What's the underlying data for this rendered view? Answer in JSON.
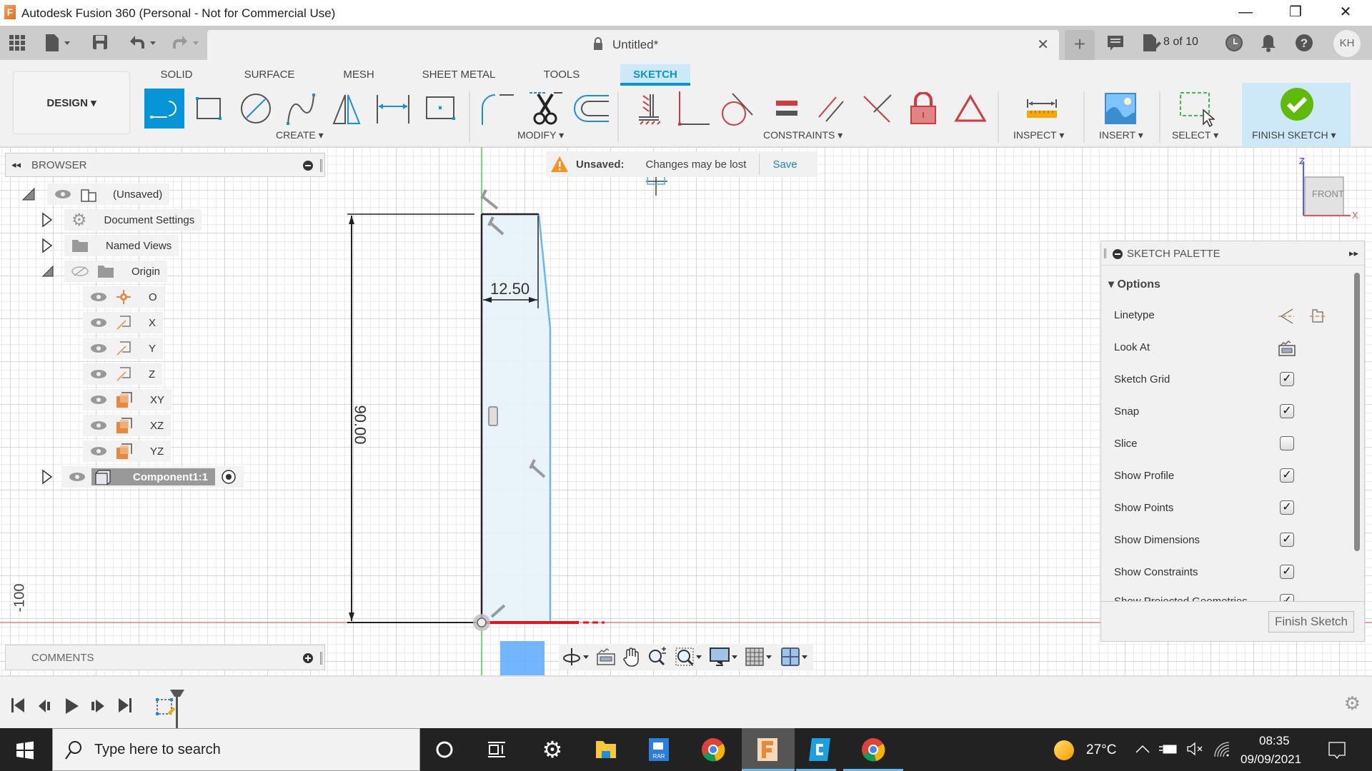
{
  "titlebar": {
    "title": "Autodesk Fusion 360 (Personal - Not for Commercial Use)",
    "logo": "F",
    "minimize": "—",
    "restore": "❐",
    "close": "✕"
  },
  "quickbar": {
    "doc_title": "Untitled*",
    "doc_close": "✕",
    "new_tab": "+",
    "job_status": "8 of 10",
    "user_initials": "KH"
  },
  "ribbon": {
    "workspace": "DESIGN ▾",
    "tabs": [
      {
        "label": "SOLID",
        "active": false
      },
      {
        "label": "SURFACE",
        "active": false
      },
      {
        "label": "MESH",
        "active": false
      },
      {
        "label": "SHEET METAL",
        "active": false
      },
      {
        "label": "TOOLS",
        "active": false
      },
      {
        "label": "SKETCH",
        "active": true
      }
    ],
    "groups": {
      "create": "CREATE ▾",
      "modify": "MODIFY ▾",
      "constraints": "CONSTRAINTS ▾",
      "inspect": "INSPECT ▾",
      "insert": "INSERT ▾",
      "select": "SELECT ▾",
      "finish": "FINISH SKETCH ▾"
    }
  },
  "browser": {
    "title": "BROWSER",
    "items": [
      {
        "label": "(Unsaved)",
        "icon": "component-icon"
      },
      {
        "label": "Document Settings",
        "icon": "gear-icon"
      },
      {
        "label": "Named Views",
        "icon": "folder-icon"
      },
      {
        "label": "Origin",
        "icon": "folder-icon"
      },
      {
        "label": "O",
        "icon": "origin-point-icon"
      },
      {
        "label": "X",
        "icon": "axis-icon"
      },
      {
        "label": "Y",
        "icon": "axis-icon"
      },
      {
        "label": "Z",
        "icon": "axis-icon"
      },
      {
        "label": "XY",
        "icon": "plane-icon"
      },
      {
        "label": "XZ",
        "icon": "plane-icon"
      },
      {
        "label": "YZ",
        "icon": "plane-icon"
      },
      {
        "label": "Component1:1",
        "icon": "component-box-icon"
      }
    ]
  },
  "notification": {
    "label": "Unsaved:",
    "message": "Changes may be lost",
    "action": "Save"
  },
  "sketch": {
    "dim_width": "12.50",
    "dim_height": "90.00",
    "axis_label": "-100",
    "viewcube_face": "FRONT",
    "viewcube_z": "Z",
    "viewcube_x": "X"
  },
  "palette": {
    "title": "SKETCH PALETTE",
    "section": "Options",
    "rows": [
      {
        "label": "Linetype",
        "type": "icons"
      },
      {
        "label": "Look At",
        "type": "icon"
      },
      {
        "label": "Sketch Grid",
        "checked": true
      },
      {
        "label": "Snap",
        "checked": true
      },
      {
        "label": "Slice",
        "checked": false
      },
      {
        "label": "Show Profile",
        "checked": true
      },
      {
        "label": "Show Points",
        "checked": true
      },
      {
        "label": "Show Dimensions",
        "checked": true
      },
      {
        "label": "Show Constraints",
        "checked": true
      },
      {
        "label": "Show Projected Geometries",
        "checked": true
      }
    ],
    "finish_button": "Finish Sketch"
  },
  "comments": {
    "title": "COMMENTS"
  },
  "taskbar": {
    "search_placeholder": "Type here to search",
    "temperature": "27°C",
    "time": "08:35",
    "date": "09/09/2021"
  },
  "colors": {
    "accent": "#0696d7",
    "finish_green": "#5fba0a",
    "constraint_red": "#d23b3b",
    "profile_fill": "#e6f2fa"
  }
}
